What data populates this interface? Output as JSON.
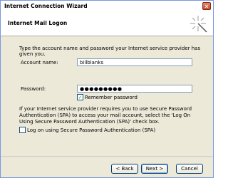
{
  "window": {
    "title": "Internet Connection Wizard"
  },
  "header": {
    "title": "Internet Mail Logon"
  },
  "intro_text": "Type the account name and password your Internet service provider has given you.",
  "account": {
    "label": "Account name:",
    "value": "billblanks"
  },
  "password": {
    "label": "Password:",
    "value": "●●●●●●●●●"
  },
  "remember": {
    "label": "Remember password",
    "checked_glyph": "✓"
  },
  "spa": {
    "info": "If your Internet service provider requires you to use Secure Password Authentication (SPA) to access your mail account, select the 'Log On Using Secure Password Authentication (SPA)' check box.",
    "label": "Log on using Secure Password Authentication (SPA)"
  },
  "buttons": {
    "back": "< Back",
    "next": "Next >",
    "cancel": "Cancel"
  },
  "icons": {
    "close": "close-icon",
    "wizard": "wizard-sparkle-icon"
  }
}
